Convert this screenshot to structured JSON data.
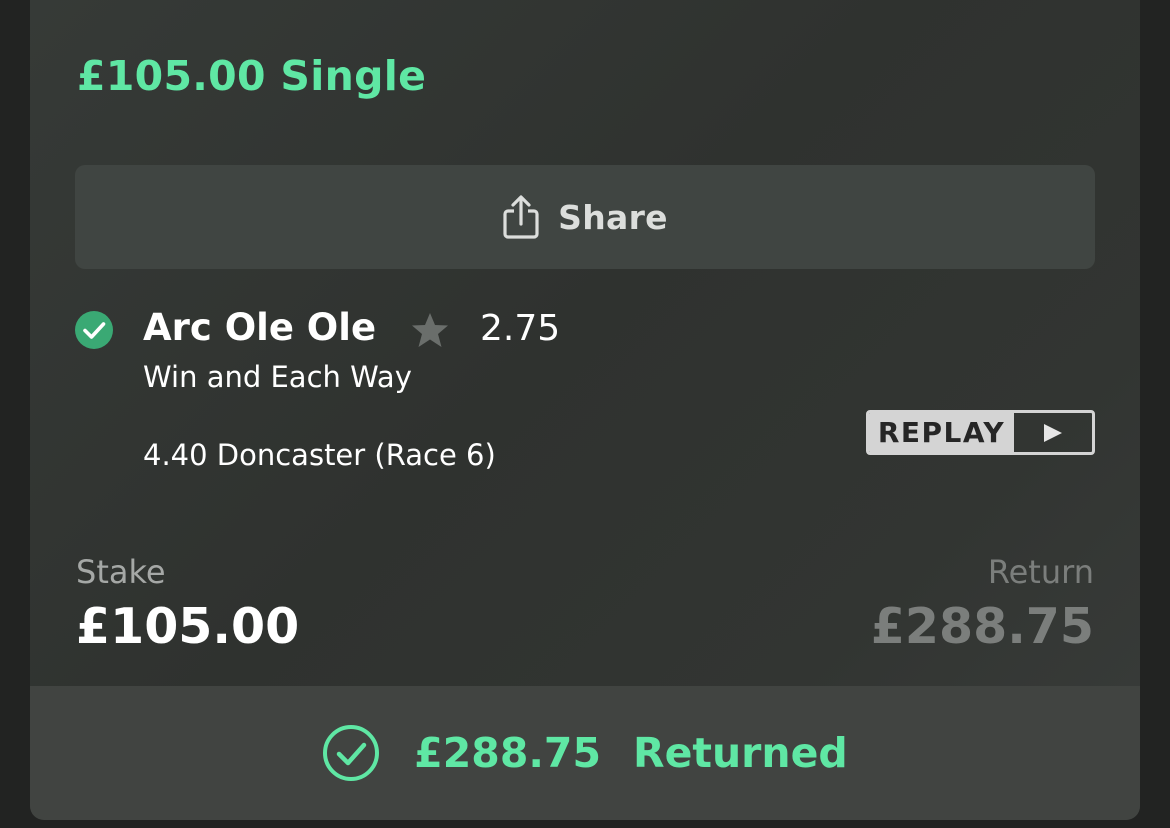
{
  "bet": {
    "title": "£105.00 Single",
    "share_label": "Share",
    "selection_name": "Arc Ole Ole",
    "odds": "2.75",
    "market": "Win and Each Way",
    "event": "4.40 Doncaster (Race 6)",
    "replay_label": "REPLAY",
    "stake_label": "Stake",
    "stake_value": "£105.00",
    "return_label": "Return",
    "return_value": "£288.75",
    "returned_amount": "£288.75",
    "returned_label": "Returned"
  },
  "icons": {
    "share": "share-icon",
    "win_check": "check-circle-icon",
    "favourite": "star-icon",
    "play": "play-icon",
    "returned_check": "check-circle-outline-icon"
  },
  "colors": {
    "accent_green": "#5fe7a4",
    "win_check": "#3aa974"
  }
}
